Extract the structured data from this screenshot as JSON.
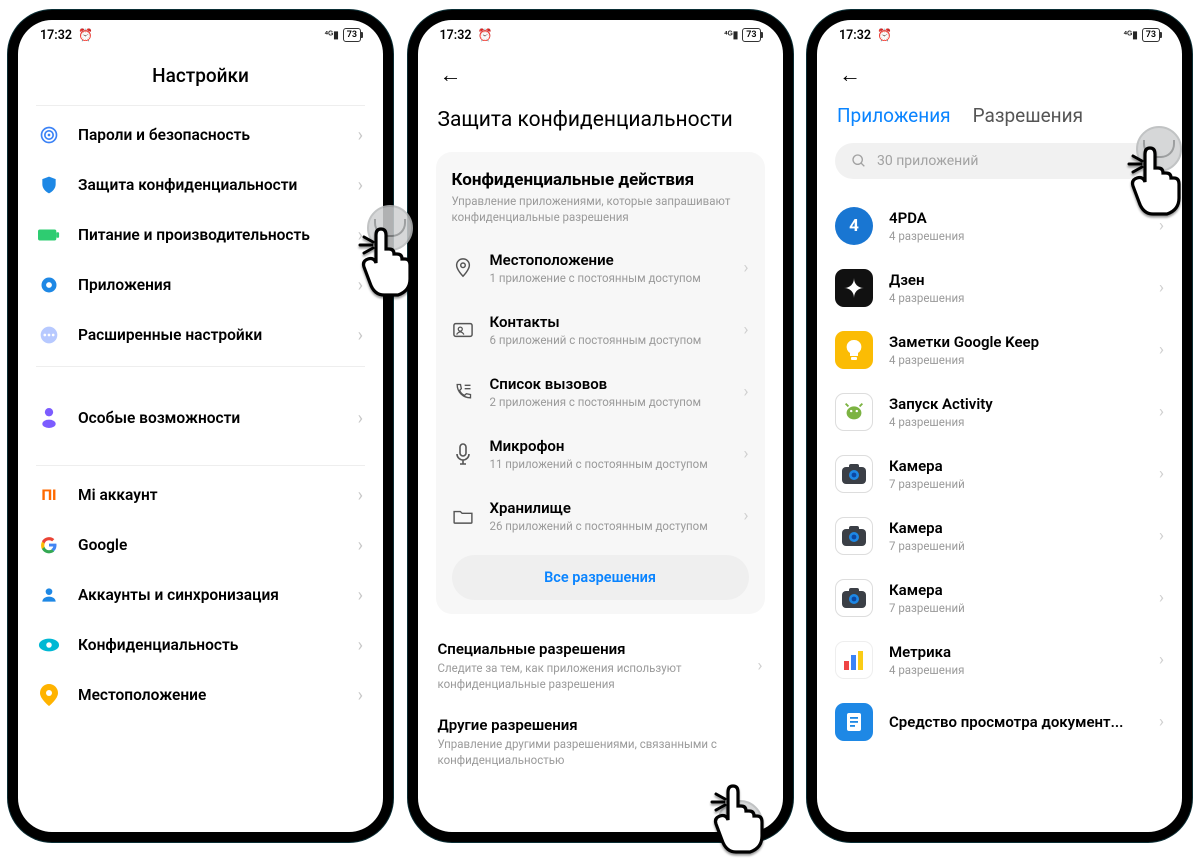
{
  "status": {
    "time": "17:32",
    "battery": "73"
  },
  "screen1": {
    "title": "Настройки",
    "items": [
      {
        "label": "Пароли и безопасность"
      },
      {
        "label": "Защита конфиденциальности"
      },
      {
        "label": "Питание и производительность"
      },
      {
        "label": "Приложения"
      },
      {
        "label": "Расширенные настройки"
      }
    ],
    "special": {
      "label": "Особые возможности"
    },
    "accounts": [
      {
        "label": "Mi аккаунт"
      },
      {
        "label": "Google"
      },
      {
        "label": "Аккаунты и синхронизация"
      },
      {
        "label": "Конфиденциальность"
      },
      {
        "label": "Местоположение"
      }
    ]
  },
  "screen2": {
    "title": "Защита конфиденциальности",
    "card": {
      "title": "Конфиденциальные действия",
      "sub": "Управление приложениями, которые запрашивают конфиденциальные разрешения",
      "rows": [
        {
          "label": "Местоположение",
          "sub": "1 приложение с постоянным доступом"
        },
        {
          "label": "Контакты",
          "sub": "6 приложений с постоянным доступом"
        },
        {
          "label": "Список вызовов",
          "sub": "2 приложения с постоянным доступом"
        },
        {
          "label": "Микрофон",
          "sub": "11 приложений с постоянным доступом"
        },
        {
          "label": "Хранилище",
          "sub": "26 приложений с постоянным доступом"
        }
      ],
      "all": "Все разрешения"
    },
    "flat": [
      {
        "label": "Специальные разрешения",
        "sub": "Следите за тем, как приложения используют конфиденциальные разрешения"
      },
      {
        "label": "Другие разрешения",
        "sub": "Управление другими разрешениями, связанными с конфиденциальностью"
      }
    ]
  },
  "screen3": {
    "tabs": {
      "active": "Приложения",
      "inactive": "Разрешения"
    },
    "search_placeholder": "30 приложений",
    "apps": [
      {
        "label": "4PDA",
        "sub": "4 разрешения"
      },
      {
        "label": "Дзен",
        "sub": "4 разрешения"
      },
      {
        "label": "Заметки Google Keep",
        "sub": "4 разрешения"
      },
      {
        "label": "Запуск Activity",
        "sub": "4 разрешения"
      },
      {
        "label": "Камера",
        "sub": "7 разрешений"
      },
      {
        "label": "Камера",
        "sub": "7 разрешений"
      },
      {
        "label": "Камера",
        "sub": "7 разрешений"
      },
      {
        "label": "Метрика",
        "sub": "4 разрешения"
      },
      {
        "label": "Средство просмотра документ..."
      }
    ]
  }
}
